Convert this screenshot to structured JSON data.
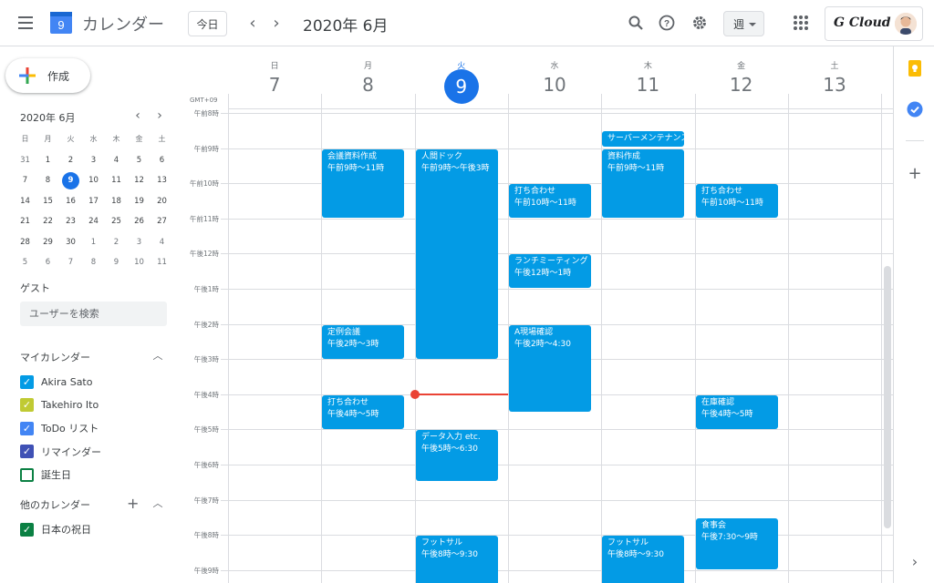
{
  "header": {
    "app_title": "カレンダー",
    "logo_day": "9",
    "today_button": "今日",
    "date_title": "2020年 6月",
    "view_select": "週",
    "brand": "G Cloud",
    "icons": [
      "menu-icon",
      "search-icon",
      "help-icon",
      "settings-icon",
      "apps-icon"
    ]
  },
  "sidebar": {
    "create_label": "作成",
    "mini_calendar": {
      "title": "2020年 6月",
      "weekdays": [
        "日",
        "月",
        "火",
        "水",
        "木",
        "金",
        "土"
      ],
      "weeks": [
        [
          "31",
          "1",
          "2",
          "3",
          "4",
          "5",
          "6"
        ],
        [
          "7",
          "8",
          "9",
          "10",
          "11",
          "12",
          "13"
        ],
        [
          "14",
          "15",
          "16",
          "17",
          "18",
          "19",
          "20"
        ],
        [
          "21",
          "22",
          "23",
          "24",
          "25",
          "26",
          "27"
        ],
        [
          "28",
          "29",
          "30",
          "1",
          "2",
          "3",
          "4"
        ],
        [
          "5",
          "6",
          "7",
          "8",
          "9",
          "10",
          "11"
        ]
      ],
      "selected": "9"
    },
    "guest_title": "ゲスト",
    "guest_placeholder": "ユーザーを検索",
    "my_calendars_title": "マイカレンダー",
    "my_calendars": [
      {
        "name": "Akira Sato",
        "color": "#039be5",
        "checked": true
      },
      {
        "name": "Takehiro Ito",
        "color": "#c0ca33",
        "checked": true
      },
      {
        "name": "ToDo リスト",
        "color": "#4285f4",
        "checked": true
      },
      {
        "name": "リマインダー",
        "color": "#3f51b5",
        "checked": true
      },
      {
        "name": "誕生日",
        "color": "#0b8043",
        "checked": false
      }
    ],
    "other_calendars_title": "他のカレンダー",
    "other_calendars": [
      {
        "name": "日本の祝日",
        "color": "#0b8043",
        "checked": true
      }
    ]
  },
  "grid": {
    "timezone": "GMT+09",
    "days": [
      {
        "name": "日",
        "num": "7"
      },
      {
        "name": "月",
        "num": "8"
      },
      {
        "name": "火",
        "num": "9",
        "today": true
      },
      {
        "name": "水",
        "num": "10"
      },
      {
        "name": "木",
        "num": "11"
      },
      {
        "name": "金",
        "num": "12"
      },
      {
        "name": "土",
        "num": "13"
      }
    ],
    "time_labels": [
      "午前8時",
      "午前9時",
      "午前10時",
      "午前11時",
      "午後12時",
      "午後1時",
      "午後2時",
      "午後3時",
      "午後4時",
      "午後5時",
      "午後6時",
      "午後7時",
      "午後8時",
      "午後9時"
    ],
    "events": [
      {
        "day": 1,
        "start": 9,
        "end": 11,
        "title": "会議資料作成",
        "time": "午前9時～11時"
      },
      {
        "day": 1,
        "start": 14,
        "end": 15,
        "title": "定例会議",
        "time": "午後2時～3時"
      },
      {
        "day": 1,
        "start": 16,
        "end": 17,
        "title": "打ち合わせ",
        "time": "午後4時～5時"
      },
      {
        "day": 2,
        "start": 9,
        "end": 15,
        "title": "人間ドック",
        "time": "午前9時～午後3時"
      },
      {
        "day": 2,
        "start": 17,
        "end": 18.5,
        "title": "データ入力 etc.",
        "time": "午後5時～6:30"
      },
      {
        "day": 2,
        "start": 20,
        "end": 21.5,
        "title": "フットサル",
        "time": "午後8時～9:30"
      },
      {
        "day": 3,
        "start": 10,
        "end": 11,
        "title": "打ち合わせ",
        "time": "午前10時～11時"
      },
      {
        "day": 3,
        "start": 12,
        "end": 13,
        "title": "ランチミーティング",
        "time": "午後12時～1時"
      },
      {
        "day": 3,
        "start": 14,
        "end": 16.5,
        "title": "A現場確認",
        "time": "午後2時～4:30"
      },
      {
        "day": 4,
        "start": 8.5,
        "end": 9,
        "title": "サーバーメンテナンス",
        "time": ""
      },
      {
        "day": 4,
        "start": 9,
        "end": 11,
        "title": "資料作成",
        "time": "午前9時～11時"
      },
      {
        "day": 4,
        "start": 20,
        "end": 21.5,
        "title": "フットサル",
        "time": "午後8時～9:30"
      },
      {
        "day": 5,
        "start": 10,
        "end": 11,
        "title": "打ち合わせ",
        "time": "午前10時～11時"
      },
      {
        "day": 5,
        "start": 16,
        "end": 17,
        "title": "在庫確認",
        "time": "午後4時～5時"
      },
      {
        "day": 5,
        "start": 19.5,
        "end": 21,
        "title": "食事会",
        "time": "午後7:30～9時"
      }
    ],
    "now": {
      "day": 2,
      "hour": 16
    }
  },
  "colors": {
    "accent": "#1a73e8",
    "event": "#039be5",
    "now": "#ea4335"
  }
}
